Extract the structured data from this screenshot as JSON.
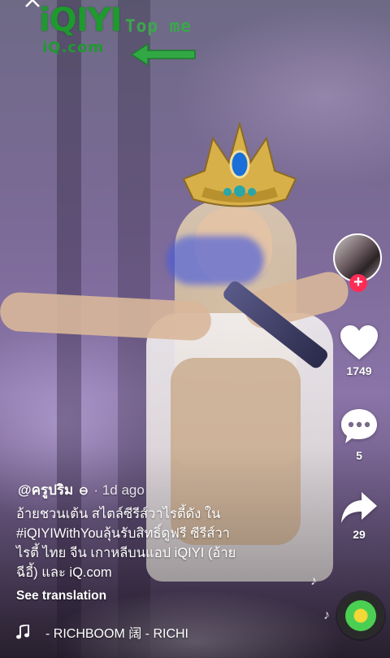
{
  "logo": {
    "text": "iQIYI",
    "sub": "iQ.com"
  },
  "watermark": {
    "top_me": "Top me"
  },
  "sidebar": {
    "likes": "1749",
    "comments": "5",
    "shares": "29"
  },
  "post": {
    "author": "@ครูปริม",
    "timestamp": "· 1d ago",
    "caption_lines": [
      "อ้ายชวนเต้น สไตล์ซีรีส์วาไรตี้ดัง ใน",
      "#iQIYIWithYouลุ้นรับสิทธิ์ดูฟรี ซีรีส์วา",
      "ไรตี้ ไทย จีน เกาหลีบนแอป iQIYI (อ้าย",
      "ฉีอี้) และ iQ.com"
    ],
    "see_translation": "See translation",
    "music": "- RICHBOOM  阔 - RICHI"
  },
  "colors": {
    "like_badge": "#fe2c55",
    "logo_green": "#1e9a2e"
  },
  "icons": [
    "back-arrow-icon",
    "green-arrow-icon",
    "heart-icon",
    "comment-icon",
    "share-icon",
    "music-note-icon",
    "plus-icon"
  ]
}
